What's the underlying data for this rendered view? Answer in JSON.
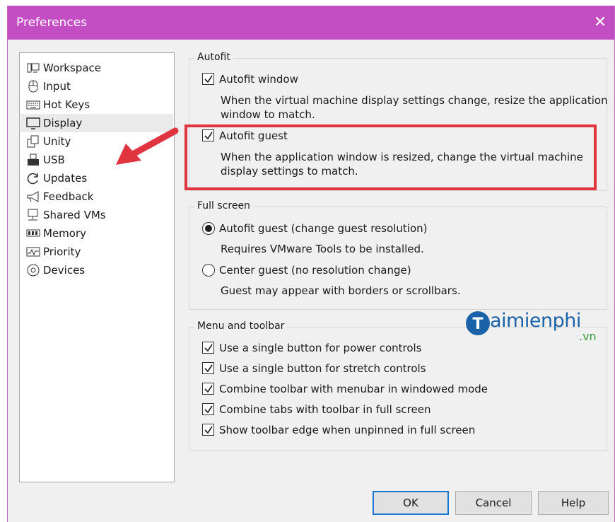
{
  "window": {
    "title": "Preferences"
  },
  "sidebar": {
    "items": [
      {
        "label": "Workspace",
        "icon": "workspace-icon"
      },
      {
        "label": "Input",
        "icon": "mouse-icon"
      },
      {
        "label": "Hot Keys",
        "icon": "keyboard-icon"
      },
      {
        "label": "Display",
        "icon": "monitor-icon",
        "selected": true
      },
      {
        "label": "Unity",
        "icon": "unity-icon"
      },
      {
        "label": "USB",
        "icon": "usb-icon"
      },
      {
        "label": "Updates",
        "icon": "refresh-icon"
      },
      {
        "label": "Feedback",
        "icon": "megaphone-icon"
      },
      {
        "label": "Shared VMs",
        "icon": "shared-vms-icon"
      },
      {
        "label": "Memory",
        "icon": "memory-icon"
      },
      {
        "label": "Priority",
        "icon": "priority-icon"
      },
      {
        "label": "Devices",
        "icon": "devices-icon"
      }
    ]
  },
  "autofit": {
    "title": "Autofit",
    "window_label": "Autofit window",
    "window_checked": true,
    "window_desc_line1": "When the virtual machine display settings change, resize the application",
    "window_desc_line2": "window to match.",
    "guest_label": "Autofit guest",
    "guest_checked": true,
    "guest_desc_line1": "When the application window is resized, change the virtual machine",
    "guest_desc_line2": "display settings to match."
  },
  "fullscreen": {
    "title": "Full screen",
    "option1_label": "Autofit guest (change guest resolution)",
    "option1_desc": "Requires VMware Tools to be installed.",
    "option1_selected": true,
    "option2_label": "Center guest (no resolution change)",
    "option2_desc": "Guest may appear with borders or scrollbars."
  },
  "menu_toolbar": {
    "title": "Menu and toolbar",
    "options": [
      {
        "label": "Use a single button for power controls",
        "checked": true
      },
      {
        "label": "Use a single button for stretch controls",
        "checked": true
      },
      {
        "label": "Combine toolbar with menubar in windowed mode",
        "checked": true
      },
      {
        "label": "Combine tabs with toolbar in full screen",
        "checked": true
      },
      {
        "label": "Show toolbar edge when unpinned in full screen",
        "checked": true
      }
    ]
  },
  "buttons": {
    "ok": "OK",
    "cancel": "Cancel",
    "help": "Help"
  },
  "watermark": {
    "main": "aimienphi",
    "sub": ".vn"
  },
  "colors": {
    "titlebar": "#c34ec3",
    "highlight": "#e0353f",
    "arrow": "#e0353f",
    "ok_border": "#1a75d2"
  }
}
